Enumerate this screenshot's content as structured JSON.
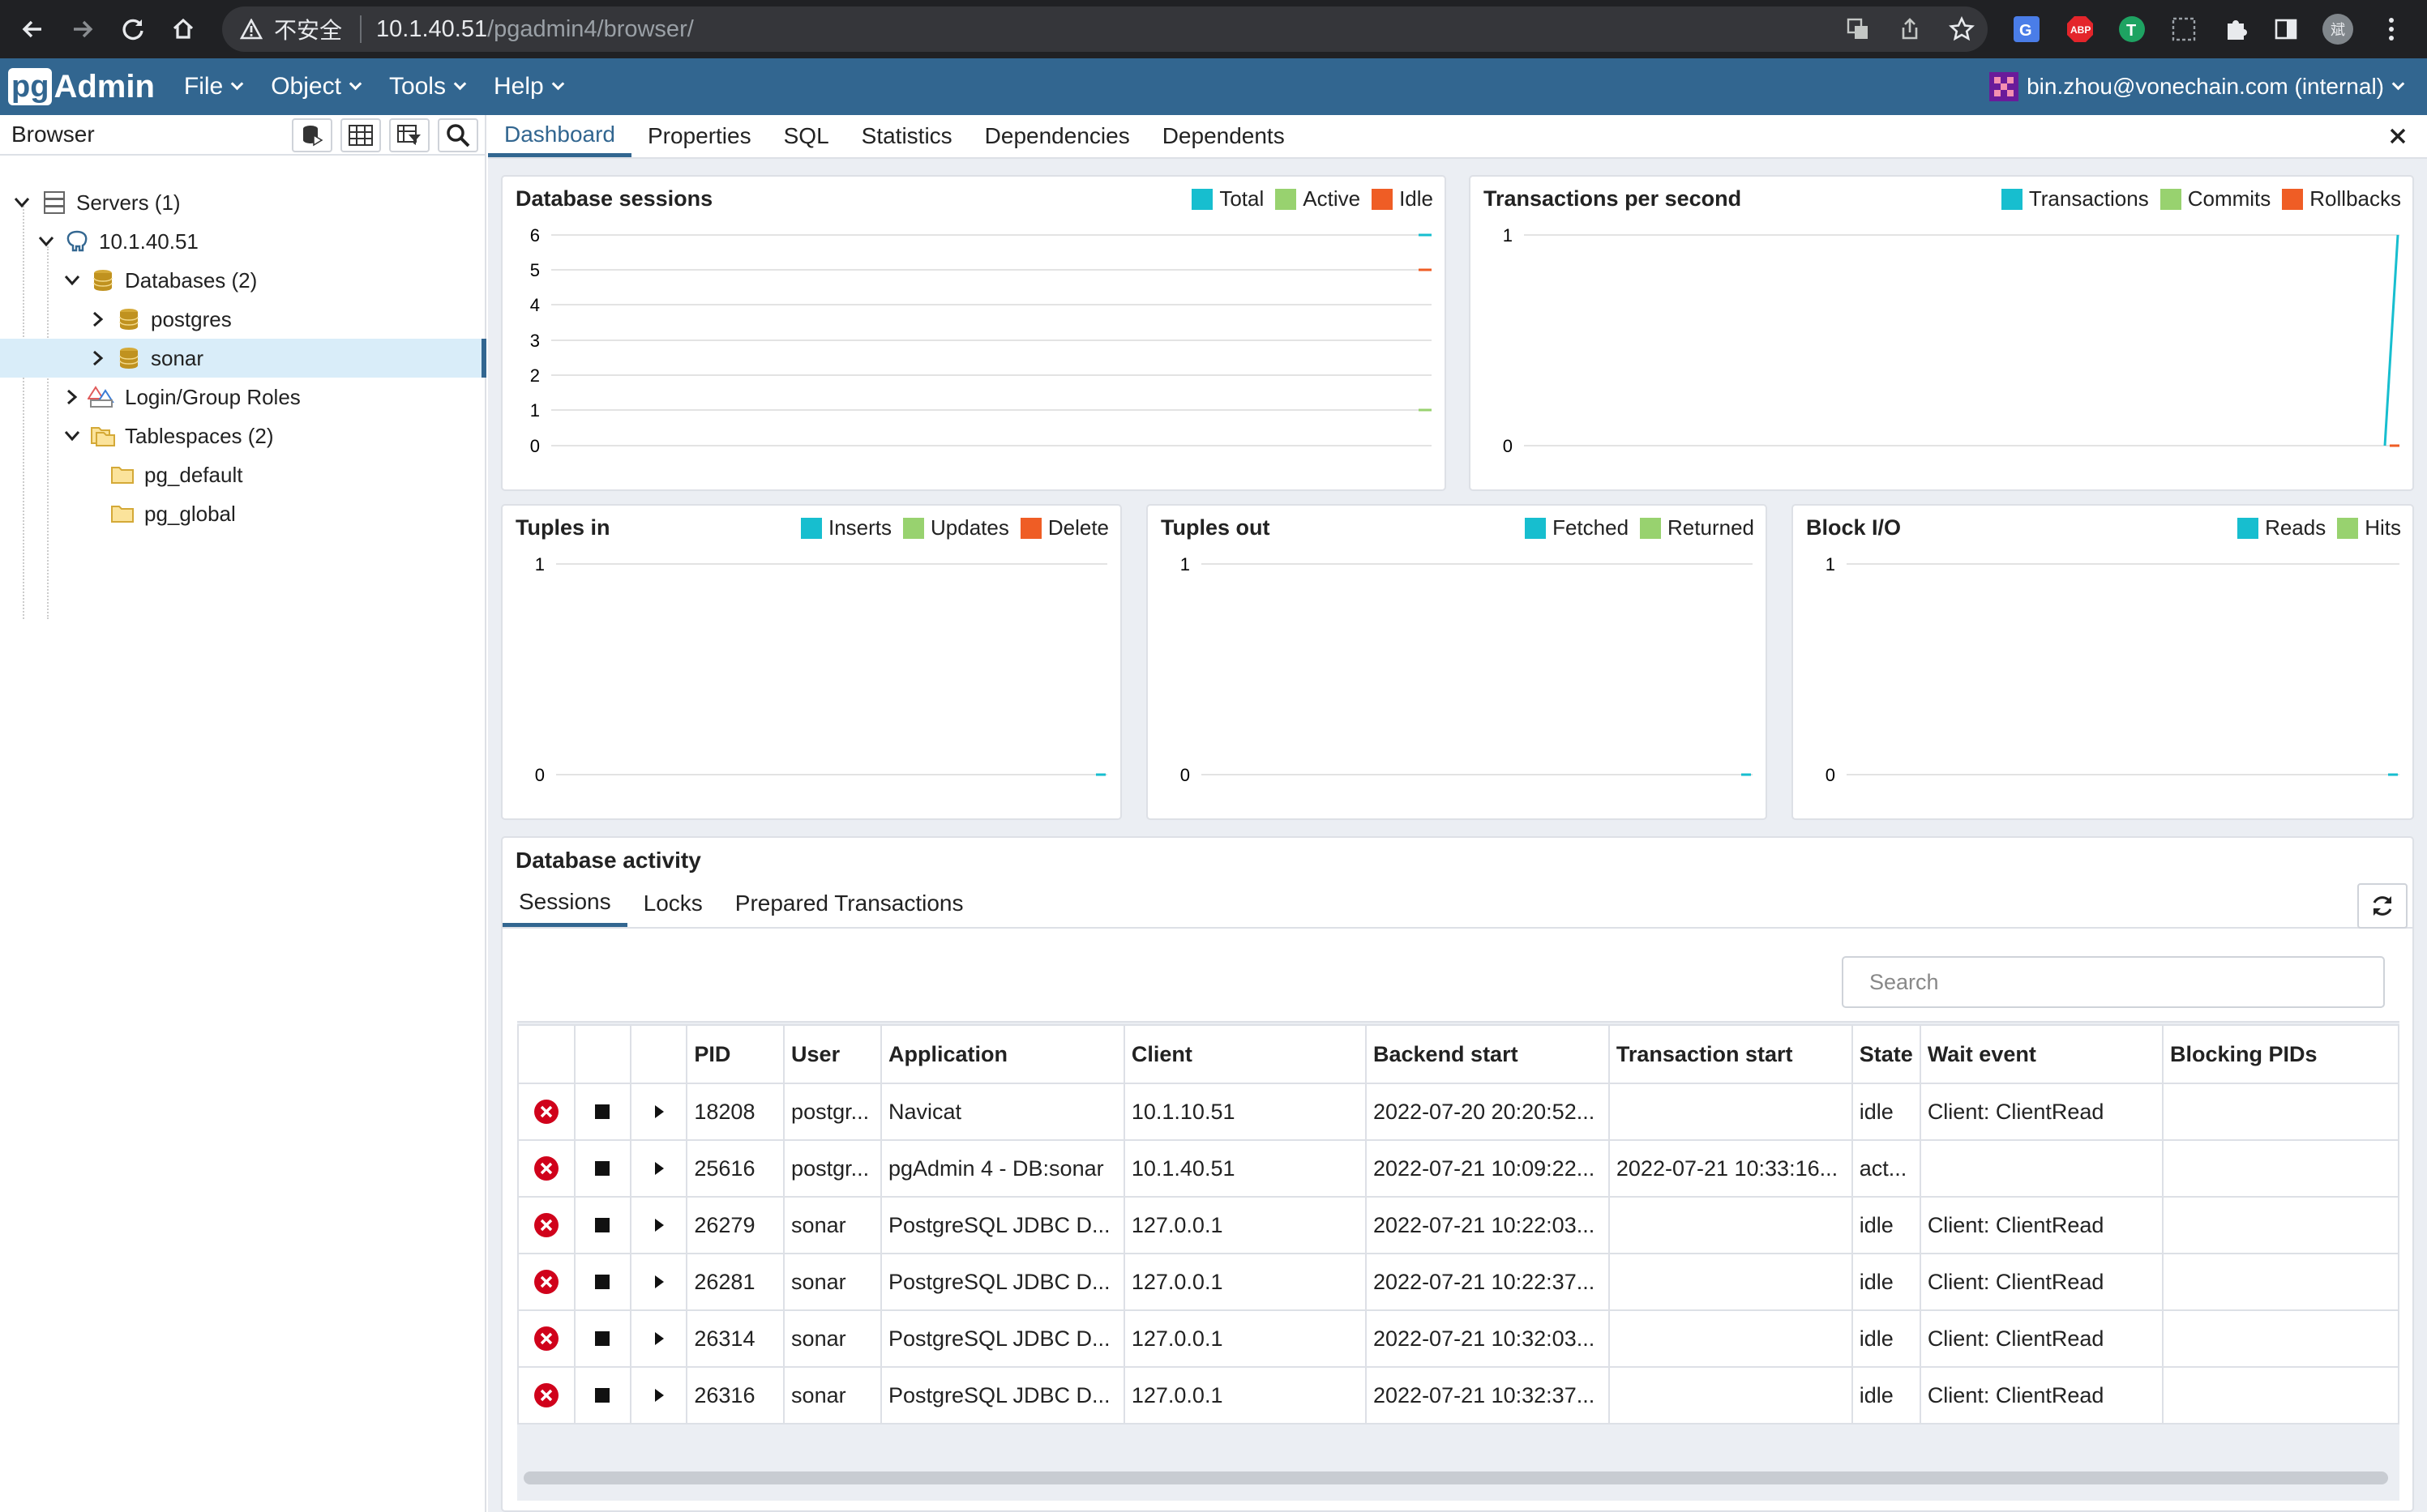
{
  "browser": {
    "insecure_label": "不安全",
    "url_host": "10.1.40.51",
    "url_path": "/pgadmin4/browser/",
    "profile_initial": "斌"
  },
  "app": {
    "logo_pg": "pg",
    "logo_admin": "Admin",
    "menus": [
      "File",
      "Object",
      "Tools",
      "Help"
    ],
    "user": "bin.zhou@vonechain.com (internal)"
  },
  "browser_panel": {
    "title": "Browser",
    "tree": [
      {
        "label": "Servers (1)"
      },
      {
        "label": "10.1.40.51"
      },
      {
        "label": "Databases (2)"
      },
      {
        "label": "postgres"
      },
      {
        "label": "sonar"
      },
      {
        "label": "Login/Group Roles"
      },
      {
        "label": "Tablespaces (2)"
      },
      {
        "label": "pg_default"
      },
      {
        "label": "pg_global"
      }
    ]
  },
  "tabs": [
    "Dashboard",
    "Properties",
    "SQL",
    "Statistics",
    "Dependencies",
    "Dependents"
  ],
  "colors": {
    "teal": "#17becf",
    "green": "#98d26f",
    "orange": "#ef5d25",
    "brand": "#326690"
  },
  "charts": {
    "sessions": {
      "title": "Database sessions",
      "legend": [
        "Total",
        "Active",
        "Idle"
      ],
      "yticks": [
        "6",
        "5",
        "4",
        "3",
        "2",
        "1",
        "0"
      ]
    },
    "tps": {
      "title": "Transactions per second",
      "legend": [
        "Transactions",
        "Commits",
        "Rollbacks"
      ],
      "yticks": [
        "1",
        "0"
      ]
    },
    "tuples_in": {
      "title": "Tuples in",
      "legend": [
        "Inserts",
        "Updates",
        "Delete"
      ],
      "yticks": [
        "1",
        "0"
      ]
    },
    "tuples_out": {
      "title": "Tuples out",
      "legend": [
        "Fetched",
        "Returned"
      ],
      "yticks": [
        "1",
        "0"
      ]
    },
    "block_io": {
      "title": "Block I/O",
      "legend": [
        "Reads",
        "Hits"
      ],
      "yticks": [
        "1",
        "0"
      ]
    }
  },
  "activity": {
    "title": "Database activity",
    "tabs": [
      "Sessions",
      "Locks",
      "Prepared Transactions"
    ],
    "search_placeholder": "Search",
    "columns": [
      "PID",
      "User",
      "Application",
      "Client",
      "Backend start",
      "Transaction start",
      "State",
      "Wait event",
      "Blocking PIDs"
    ],
    "rows": [
      [
        "18208",
        "postgr...",
        "Navicat",
        "10.1.10.51",
        "2022-07-20 20:20:52...",
        "",
        "idle",
        "Client: ClientRead",
        ""
      ],
      [
        "25616",
        "postgr...",
        "pgAdmin 4 - DB:sonar",
        "10.1.40.51",
        "2022-07-21 10:09:22...",
        "2022-07-21 10:33:16...",
        "act...",
        "",
        ""
      ],
      [
        "26279",
        "sonar",
        "PostgreSQL JDBC D...",
        "127.0.0.1",
        "2022-07-21 10:22:03...",
        "",
        "idle",
        "Client: ClientRead",
        ""
      ],
      [
        "26281",
        "sonar",
        "PostgreSQL JDBC D...",
        "127.0.0.1",
        "2022-07-21 10:22:37...",
        "",
        "idle",
        "Client: ClientRead",
        ""
      ],
      [
        "26314",
        "sonar",
        "PostgreSQL JDBC D...",
        "127.0.0.1",
        "2022-07-21 10:32:03...",
        "",
        "idle",
        "Client: ClientRead",
        ""
      ],
      [
        "26316",
        "sonar",
        "PostgreSQL JDBC D...",
        "127.0.0.1",
        "2022-07-21 10:32:37...",
        "",
        "idle",
        "Client: ClientRead",
        ""
      ]
    ]
  }
}
